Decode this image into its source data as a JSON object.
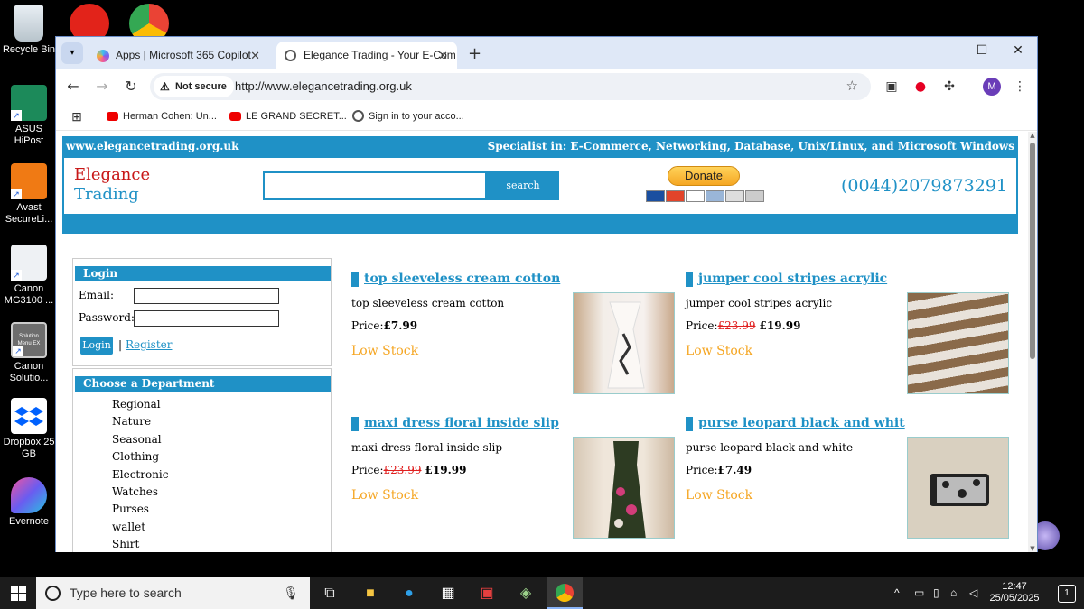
{
  "desktop": {
    "icons": [
      {
        "label": "Recycle Bin"
      },
      {
        "label": "ASUS HiPost"
      },
      {
        "label": "Avast SecureLi..."
      },
      {
        "label": "Canon MG3100 ..."
      },
      {
        "label": "Canon Solutio..."
      },
      {
        "label": "Dropbox 25 GB"
      },
      {
        "label": "Evernote"
      }
    ],
    "solution_icon_text": "Solution Menu EX"
  },
  "browser": {
    "tabs": [
      {
        "title": "Apps | Microsoft 365 Copilot",
        "active": false
      },
      {
        "title": "Elegance Trading - Your E-Com",
        "active": true
      }
    ],
    "new_tab": "+",
    "security_label": "Not secure",
    "url": "http://www.elegancetrading.org.uk",
    "avatar_initial": "M",
    "bookmarks": [
      {
        "label": "Herman Cohen: Un...",
        "icon": "youtube-icon"
      },
      {
        "label": "LE GRAND SECRET...",
        "icon": "youtube-icon"
      },
      {
        "label": "Sign in to your acco...",
        "icon": "globe-icon"
      }
    ]
  },
  "site": {
    "domain": "www.elegancetrading.org.uk",
    "specialist": "Specialist in: E-Commerce, Networking, Database, Unix/Linux, and Microsoft Windows",
    "logo_line1": "Elegance",
    "logo_line2": "Trading",
    "search_button": "search",
    "donate_button": "Donate",
    "phone": "(0044)2079873291",
    "colors": {
      "brand": "#1f91c6",
      "logo_red": "#c81818",
      "stock": "#f5a623",
      "old_price": "#e02020"
    }
  },
  "login": {
    "title": "Login",
    "email_label": "Email:",
    "password_label": "Password:",
    "login_button": "Login",
    "separator": "|",
    "register_link": "Register"
  },
  "departments": {
    "title": "Choose a Department",
    "items": [
      "Regional",
      "Nature",
      "Seasonal",
      "Clothing",
      "Electronic",
      "Watches",
      "Purses",
      "wallet",
      "Shirt"
    ]
  },
  "products": [
    {
      "title": "top sleeveless cream cotton",
      "desc": "top sleeveless cream cotton",
      "price_label": "Price:",
      "old_price": "",
      "price": "£7.99",
      "stock": "Low Stock"
    },
    {
      "title": "jumper cool stripes acrylic",
      "desc": "jumper cool stripes acrylic",
      "price_label": "Price:",
      "old_price": "£23.99",
      "price": "£19.99",
      "stock": "Low Stock"
    },
    {
      "title": "maxi dress floral inside slip",
      "desc": "maxi dress floral inside slip",
      "price_label": "Price:",
      "old_price": "£23.99",
      "price": "£19.99",
      "stock": "Low Stock"
    },
    {
      "title": "purse leopard black and whit",
      "desc": "purse leopard black and white",
      "price_label": "Price:",
      "old_price": "",
      "price": "£7.49",
      "stock": "Low Stock"
    }
  ],
  "taskbar": {
    "search_placeholder": "Type here to search",
    "time": "12:47",
    "date": "25/05/2025",
    "notification_count": "1"
  }
}
